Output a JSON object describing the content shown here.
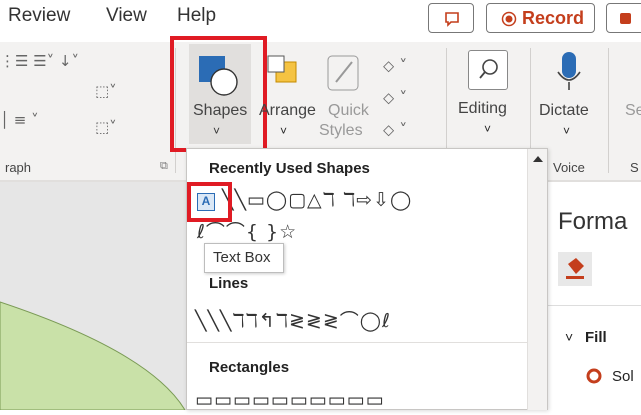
{
  "menu": {
    "tabs": [
      "Review",
      "View",
      "Help"
    ],
    "record_label": "Record"
  },
  "ribbon": {
    "shapes_label": "Shapes",
    "arrange_label": "Arrange",
    "quick_styles_label1": "Quick",
    "quick_styles_label2": "Styles",
    "editing_label": "Editing",
    "dictate_label": "Dictate",
    "sensitivity_partial": "Se",
    "group_paragraph_partial": "raph",
    "group_voice_label": "Voice",
    "group_s_partial": "S"
  },
  "dropdown": {
    "recently_used_title": "Recently Used Shapes",
    "lines_title": "Lines",
    "rectangles_title": "Rectangles",
    "recent_row1": "╲╲▭◯▢△ℸ ℸ⇨⇩◯",
    "recent_row2": "ℓ⌒⌒{ }☆",
    "lines_row": "╲╲╲ℸℸ↰ℸ≷≷≷⌒◯ℓ",
    "rect_row": "▭▭▭▭▭▭▭▭▭▭"
  },
  "tooltip": "Text Box",
  "format_pane": {
    "title_partial": "Forma",
    "fill_label": "Fill",
    "solid_partial": "Sol"
  },
  "colors": {
    "accent": "#c43e1c",
    "highlight": "#e01b24",
    "shapes_blue": "#2b6cb5",
    "ribbon_bg": "#f3f2f1"
  }
}
